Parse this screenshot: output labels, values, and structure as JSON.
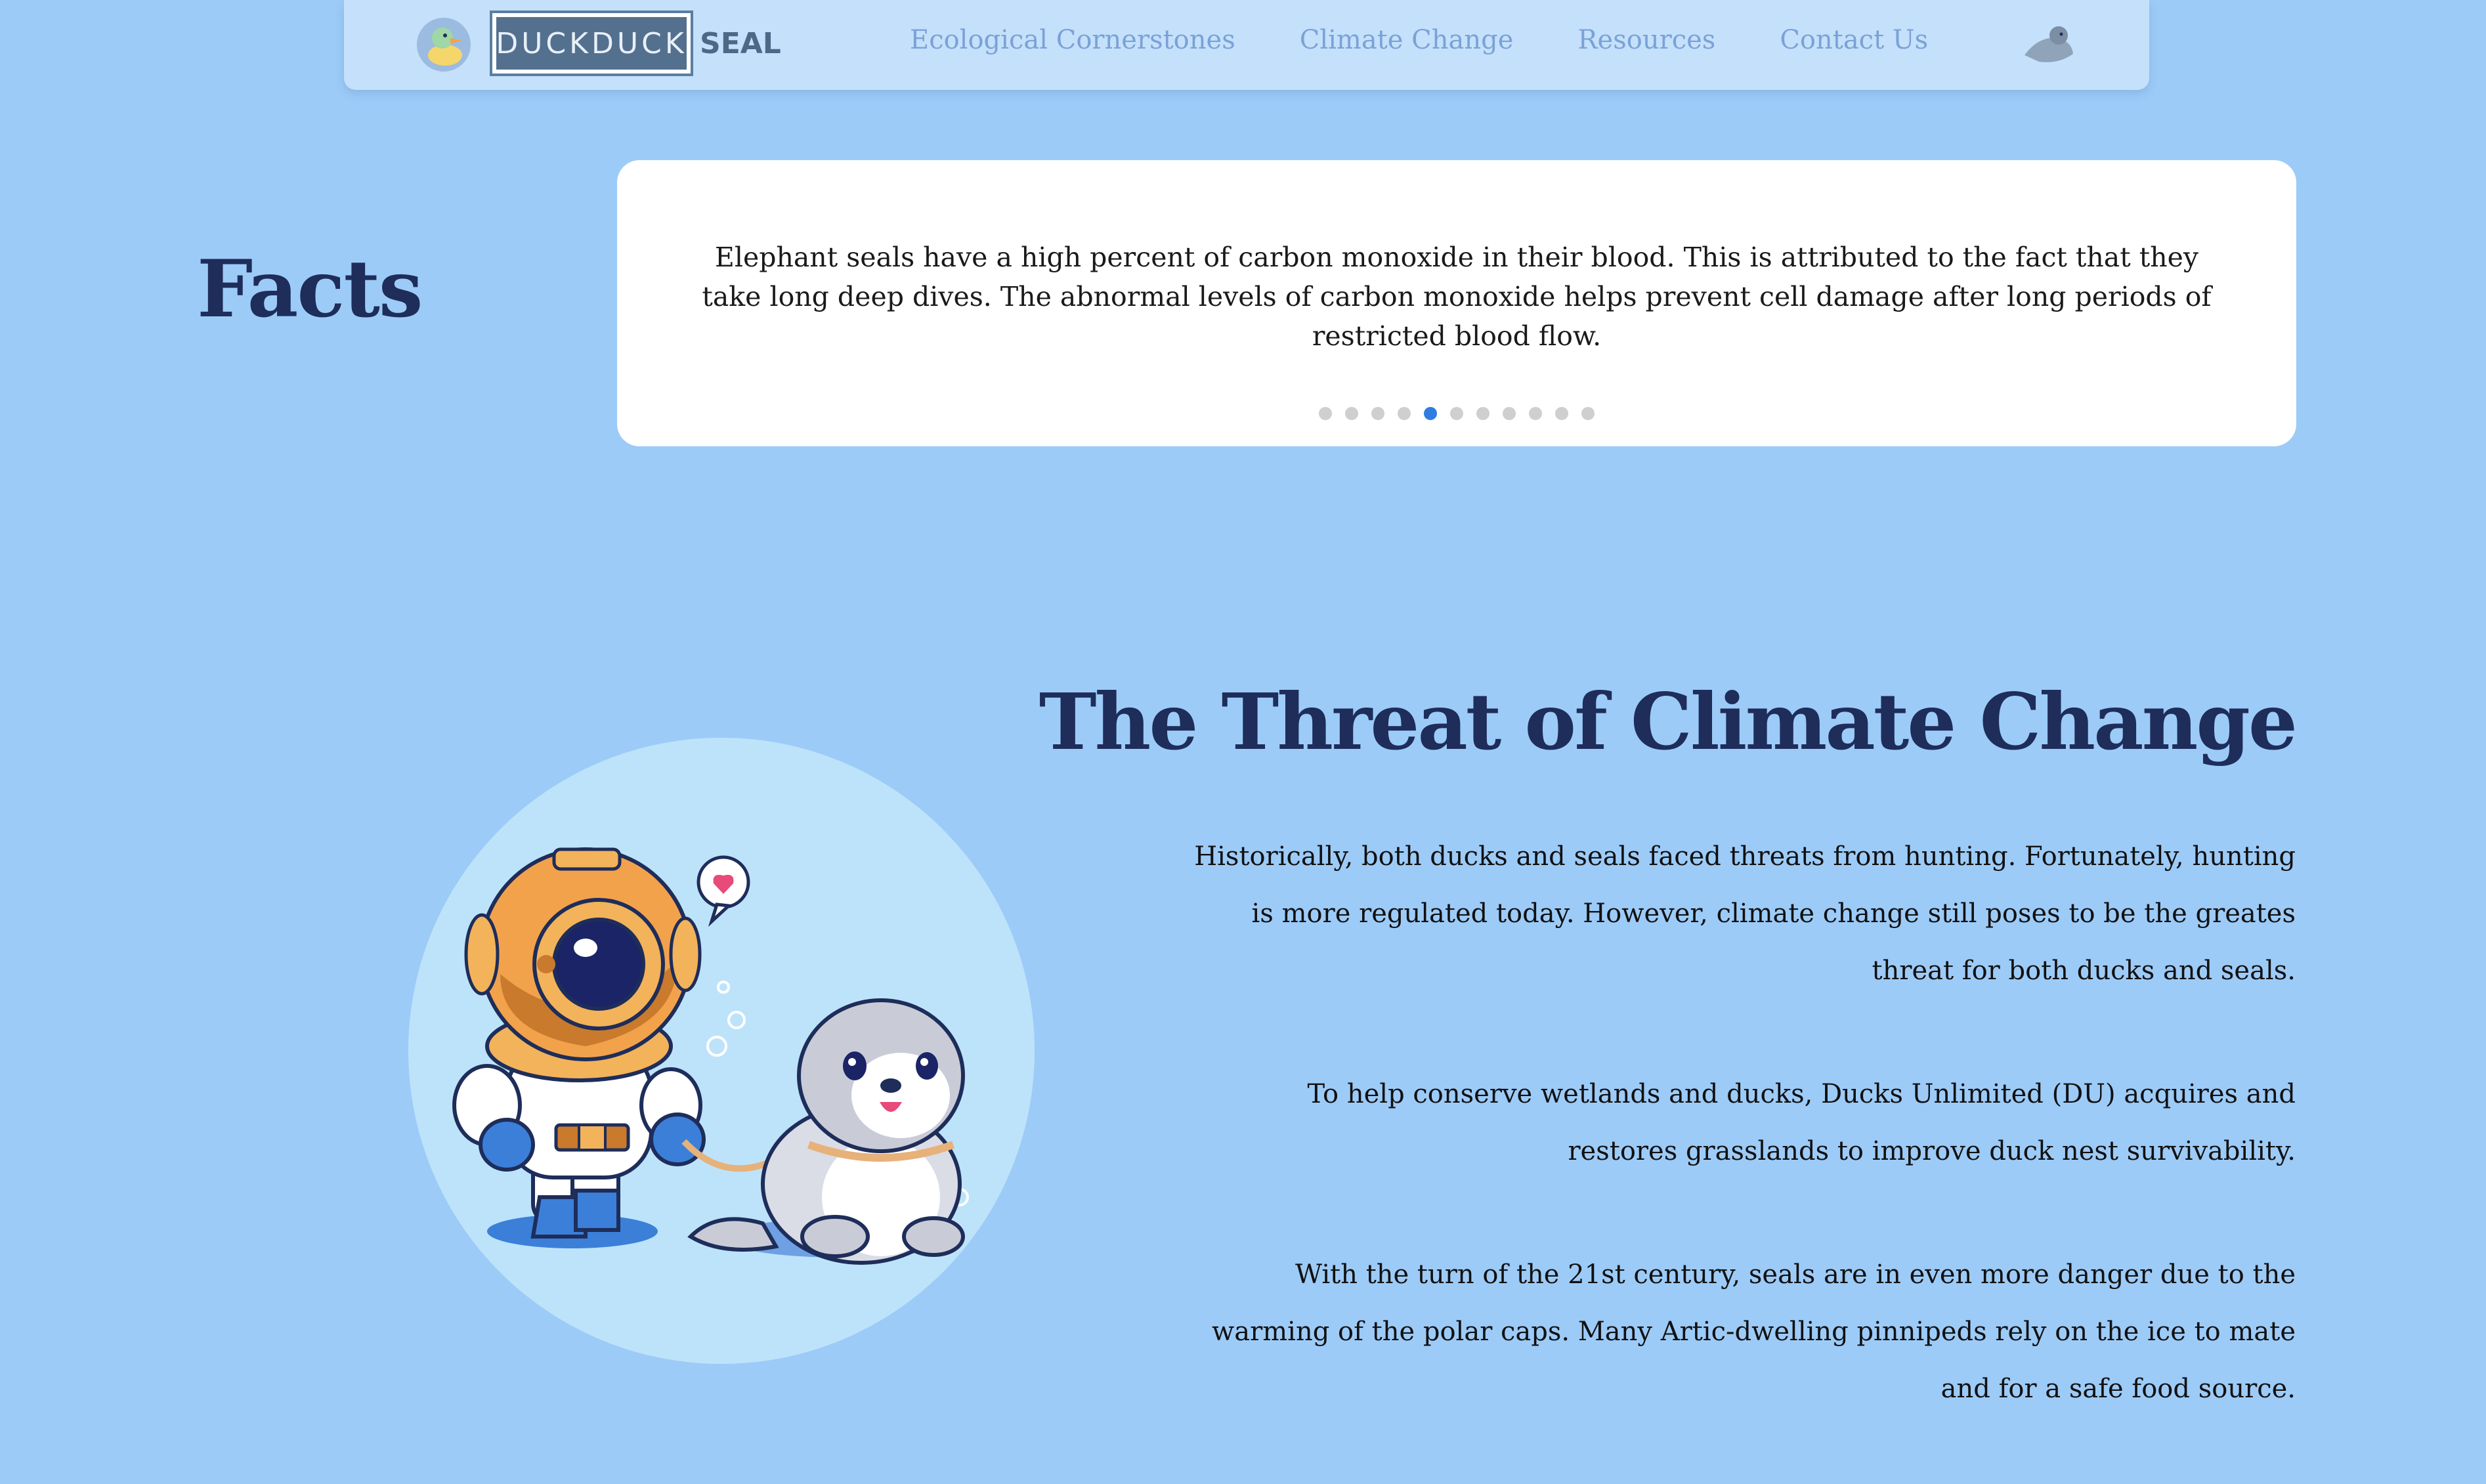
{
  "nav": {
    "logo_left": "DUCKDUCK",
    "logo_right": "SEAL",
    "links": [
      "Ecological Cornerstones",
      "Climate Change",
      "Resources",
      "Contact Us"
    ],
    "left_icon": "duck-avatar-icon",
    "right_icon": "seal-avatar-icon"
  },
  "facts": {
    "title": "Facts",
    "text": "Elephant seals have a high percent of carbon monoxide in their blood. This is attributed to the fact that they take long deep dives. The abnormal levels of carbon monoxide helps prevent cell damage after long periods of restricted blood flow.",
    "dot_count": 11,
    "active_dot_index": 4
  },
  "threat": {
    "title": "The Threat of Climate Change",
    "paragraphs": [
      "Historically, both ducks and seals faced threats from hunting. Fortunately, hunting is more regulated today. However, climate change still poses to be the greates threat for both ducks and seals.",
      "To help conserve wetlands and ducks, Ducks Unlimited (DU) acquires and restores grasslands to improve duck nest survivability.",
      "With the turn of the 21st century, seals are in even more danger due to the warming of the polar caps. Many Artic-dwelling pinnipeds rely on the ice to mate and for a safe food source."
    ]
  },
  "illustration": {
    "icon": "diver-and-seal-illustration"
  },
  "colors": {
    "page_bg": "#9dcbf8",
    "nav_bg": "#c5e0fb",
    "heading": "#1e2d5a",
    "nav_link": "#7aa2d6",
    "dot_active": "#2f7de1",
    "dot_inactive": "#cfcfcf"
  }
}
